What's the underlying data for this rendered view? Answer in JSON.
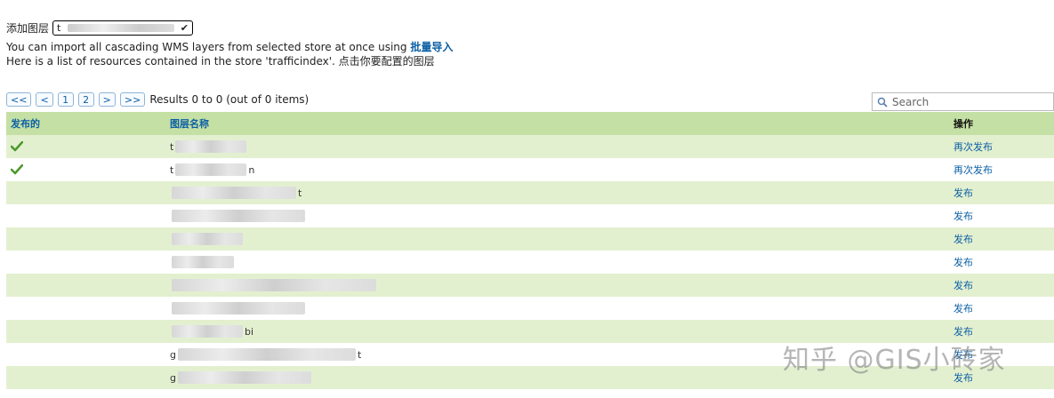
{
  "header": {
    "add_layer_label": "添加图层",
    "store_select_value": "t",
    "import_text": "You can import all cascading WMS layers from selected store at once using",
    "import_link": "批量导入",
    "resources_text": "Here is a list of resources contained in the store 'trafficindex'. 点击你要配置的图层"
  },
  "pager": {
    "first": "<<",
    "prev": "<",
    "page1": "1",
    "page2": "2",
    "next": ">",
    "last": ">>",
    "results": "Results 0 to 0 (out of 0 items)"
  },
  "search": {
    "placeholder": "Search"
  },
  "table": {
    "headers": {
      "published": "发布的",
      "layer_name": "图层名称",
      "action": "操作"
    },
    "rows": [
      {
        "published": true,
        "name_prefix": "t",
        "name_suffix": "",
        "action": "再次发布",
        "mask_w": 80
      },
      {
        "published": true,
        "name_prefix": "t",
        "name_suffix": "n",
        "action": "再次发布",
        "mask_w": 80
      },
      {
        "published": false,
        "name_prefix": "",
        "name_suffix": "t",
        "action": "发布",
        "mask_w": 140
      },
      {
        "published": false,
        "name_prefix": "",
        "name_suffix": "",
        "action": "发布",
        "mask_w": 150
      },
      {
        "published": false,
        "name_prefix": "",
        "name_suffix": "",
        "action": "发布",
        "mask_w": 80
      },
      {
        "published": false,
        "name_prefix": "",
        "name_suffix": "",
        "action": "发布",
        "mask_w": 70
      },
      {
        "published": false,
        "name_prefix": "",
        "name_suffix": "",
        "action": "发布",
        "mask_w": 230
      },
      {
        "published": false,
        "name_prefix": "",
        "name_suffix": "",
        "action": "发布",
        "mask_w": 150
      },
      {
        "published": false,
        "name_prefix": "",
        "name_suffix": "bi",
        "action": "发布",
        "mask_w": 80
      },
      {
        "published": false,
        "name_prefix": "g",
        "name_suffix": "t",
        "action": "发布",
        "mask_w": 200
      },
      {
        "published": false,
        "name_prefix": "g",
        "name_suffix": "",
        "action": "发布",
        "mask_w": 150
      }
    ]
  },
  "watermark": "知乎 @GIS小砖家",
  "colors": {
    "header_bg": "#c5e0a4",
    "odd_row": "#e3f0d0",
    "link": "#0b5fa5",
    "check": "#4a9a2a"
  }
}
